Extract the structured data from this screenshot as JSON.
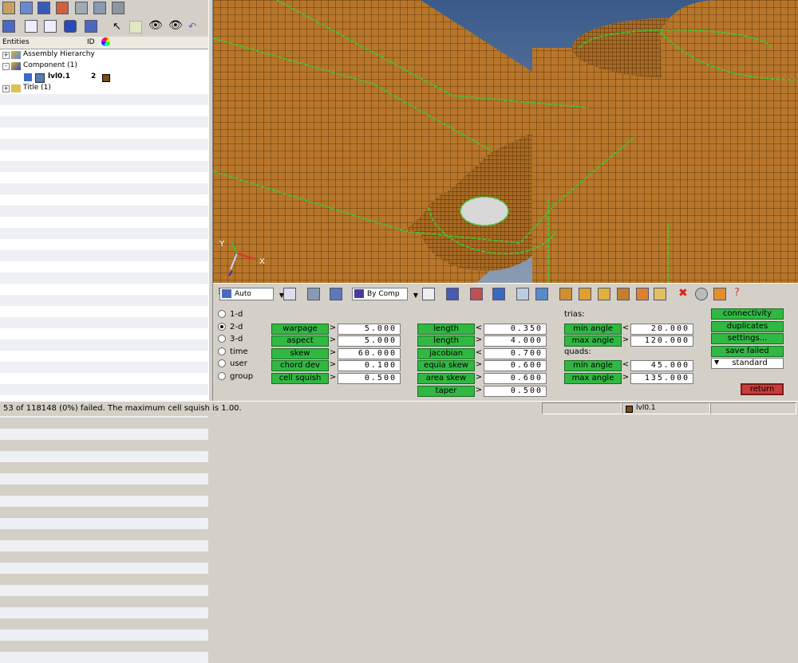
{
  "entities_header": {
    "col_entities": "Entities",
    "col_id": "ID"
  },
  "tree": [
    {
      "label": "Assembly Hierarchy",
      "expander": "+",
      "icon": "assembly-hierarchy-icon"
    },
    {
      "label": "Component (1)",
      "expander": "-",
      "icon": "component-folder-icon"
    },
    {
      "label": "lvl0.1",
      "id": "2",
      "icon": "component-icon",
      "color": "#7a4a1a"
    },
    {
      "label": "Title (1)",
      "expander": "+",
      "icon": "title-folder-icon"
    }
  ],
  "view_toolbar": {
    "auto_combo": "Auto",
    "bycomp_combo": "By Comp"
  },
  "axis_labels": {
    "x": "X",
    "y": "Y"
  },
  "panel": {
    "radios": [
      {
        "label": "1-d",
        "checked": false
      },
      {
        "label": "2-d",
        "checked": true
      },
      {
        "label": "3-d",
        "checked": false
      },
      {
        "label": "time",
        "checked": false
      },
      {
        "label": "user",
        "checked": false
      },
      {
        "label": "group",
        "checked": false
      }
    ],
    "col1": [
      {
        "label": "warpage",
        "op": ">",
        "value": "5.000"
      },
      {
        "label": "aspect",
        "op": ">",
        "value": "5.000"
      },
      {
        "label": "skew",
        "op": ">",
        "value": "60.000"
      },
      {
        "label": "chord dev",
        "op": ">",
        "value": "0.100"
      },
      {
        "label": "cell squish",
        "op": ">",
        "value": "0.500"
      }
    ],
    "col2": [
      {
        "label": "length",
        "op": "<",
        "value": "0.350"
      },
      {
        "label": "length",
        "op": ">",
        "value": "4.000"
      },
      {
        "label": "jacobian",
        "op": "<",
        "value": "0.700"
      },
      {
        "label": "equia skew",
        "op": ">",
        "value": "0.600"
      },
      {
        "label": "area skew",
        "op": ">",
        "value": "0.600"
      },
      {
        "label": "taper",
        "op": ">",
        "value": "0.500"
      }
    ],
    "trias_label": "trias:",
    "trias": [
      {
        "label": "min angle",
        "op": "<",
        "value": "20.000"
      },
      {
        "label": "max angle",
        "op": ">",
        "value": "120.000"
      }
    ],
    "quads_label": "quads:",
    "quads": [
      {
        "label": "min angle",
        "op": "<",
        "value": "45.000"
      },
      {
        "label": "max angle",
        "op": ">",
        "value": "135.000"
      }
    ],
    "actions": [
      "connectivity",
      "duplicates",
      "settings...",
      "save failed"
    ],
    "standard_select": "standard",
    "return_label": "return"
  },
  "status": {
    "message": "53 of 118148 (0%) failed.  The maximum cell squish is 1.00.",
    "component": "lvl0.1",
    "component_color": "#7a4a1a"
  },
  "colors": {
    "mesh": "#b8762a",
    "mesh_dark": "#8a5418",
    "feature_edge": "#2fd02f",
    "sky_top": "#3a5a8a",
    "sky_bottom": "#8a9cb3",
    "green_button": "#31b843",
    "return_button": "#c83c3c"
  }
}
